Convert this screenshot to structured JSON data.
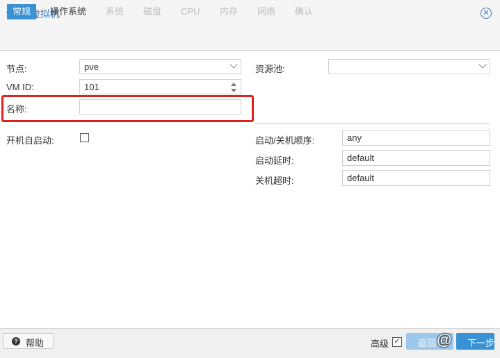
{
  "window": {
    "title": "创建: 虚拟机"
  },
  "tabs": [
    {
      "label": "常规",
      "state": "active"
    },
    {
      "label": "操作系统",
      "state": "enabled"
    },
    {
      "label": "系统",
      "state": "disabled"
    },
    {
      "label": "磁盘",
      "state": "disabled"
    },
    {
      "label": "CPU",
      "state": "disabled"
    },
    {
      "label": "内存",
      "state": "disabled"
    },
    {
      "label": "网络",
      "state": "disabled"
    },
    {
      "label": "确认",
      "state": "disabled"
    }
  ],
  "form": {
    "node": {
      "label": "节点:",
      "value": "pve"
    },
    "vmid": {
      "label": "VM ID:",
      "value": "101"
    },
    "name": {
      "label": "名称:",
      "value": ""
    },
    "resource_pool": {
      "label": "资源池:",
      "value": ""
    },
    "start_at_boot": {
      "label": "开机自启动:",
      "checked": false
    },
    "startup_order": {
      "label": "启动/关机顺序:",
      "value": "any"
    },
    "startup_delay": {
      "label": "启动延时:",
      "value": "default"
    },
    "shutdown_timeout": {
      "label": "关机超时:",
      "value": "default"
    }
  },
  "footer": {
    "help_label": "帮助",
    "advanced_label": "高级",
    "advanced_checked": true,
    "back_label": "返回",
    "next_label": "下一步",
    "watermark": "@"
  },
  "colors": {
    "accent": "#3892d4",
    "highlight": "#e02121",
    "title": "#3b78b5"
  }
}
